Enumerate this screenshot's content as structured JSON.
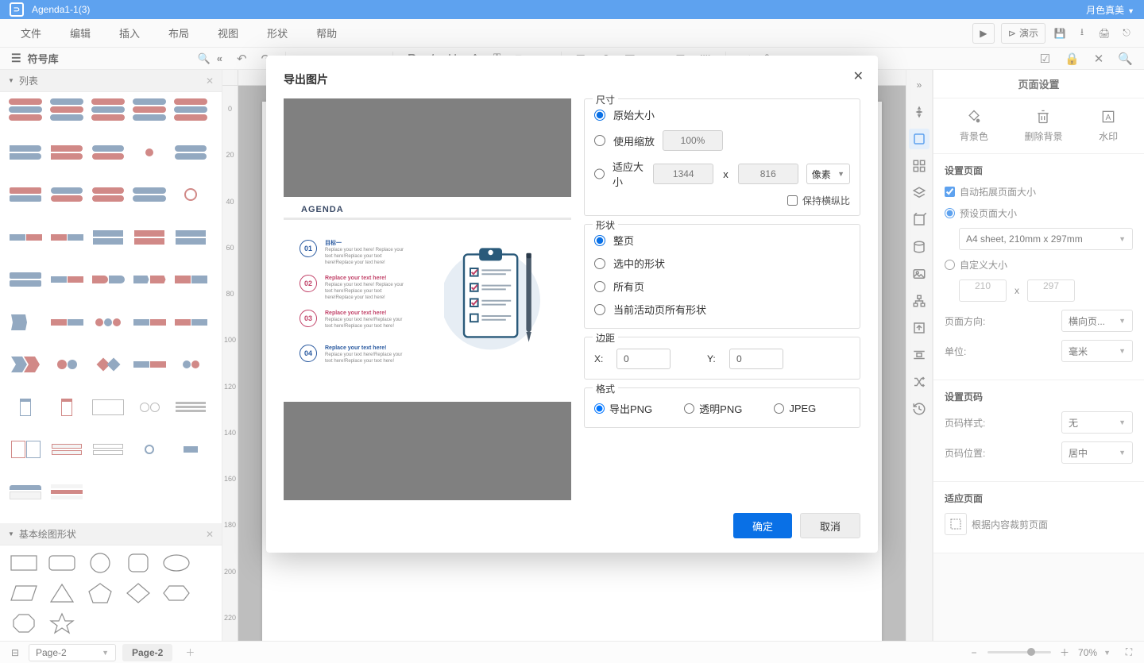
{
  "titlebar": {
    "doc_title": "Agenda1-1(3)",
    "username": "月色真美"
  },
  "menubar": {
    "items": [
      "文件",
      "编辑",
      "插入",
      "布局",
      "视图",
      "形状",
      "帮助"
    ],
    "present_label": "演示"
  },
  "toolbar": {
    "label": "符号库"
  },
  "leftpanel": {
    "section1": "列表",
    "section2": "基本绘图形状"
  },
  "ruler_v": [
    "0",
    "20",
    "40",
    "60",
    "80",
    "100",
    "120",
    "140",
    "160",
    "180",
    "200",
    "220"
  ],
  "proppanel": {
    "title": "页面设置",
    "icon_row": {
      "bgcolor": "背景色",
      "delbg": "删除背景",
      "watermark": "水印"
    },
    "section_page": {
      "title": "设置页面",
      "auto_expand": "自动拓展页面大小",
      "preset_size": "预设页面大小",
      "preset_value": "A4 sheet, 210mm x 297mm",
      "custom_size": "自定义大小",
      "custom_w": "210",
      "custom_h": "297",
      "orientation_label": "页面方向:",
      "orientation_value": "横向页...",
      "unit_label": "单位:",
      "unit_value": "毫米"
    },
    "section_num": {
      "title": "设置页码",
      "style_label": "页码样式:",
      "style_value": "无",
      "pos_label": "页码位置:",
      "pos_value": "居中"
    },
    "section_fit": {
      "title": "适应页面",
      "crop_label": "根据内容裁剪页面"
    }
  },
  "footer": {
    "page_dd": "Page-2",
    "tab": "Page-2",
    "zoom": "70%"
  },
  "modal": {
    "title": "导出图片",
    "preview": {
      "agenda_title": "AGENDA",
      "entries": [
        {
          "num": "01",
          "color": "#2a5aa0",
          "hdr": "目标一",
          "body": "Replace your text here!  Replace your text here!Replace your text here!Replace your text here!"
        },
        {
          "num": "02",
          "color": "#c2446a",
          "hdr": "Replace your text here!",
          "body": "Replace your text here!  Replace your text here!Replace your text here!Replace your text here!"
        },
        {
          "num": "03",
          "color": "#c2446a",
          "hdr": "Replace your text here!",
          "body": "Replace your text here!Replace your text here!Replace your text here!"
        },
        {
          "num": "04",
          "color": "#2a5aa0",
          "hdr": "Replace your text here!",
          "body": "Replace your text here!Replace your text here!Replace your text here!"
        }
      ]
    },
    "size": {
      "legend": "尺寸",
      "original": "原始大小",
      "scale": "使用缩放",
      "scale_ph": "100%",
      "fit": "适应大小",
      "fit_w": "1344",
      "fit_h": "816",
      "fit_unit": "像素",
      "keep_ratio": "保持横纵比"
    },
    "shape": {
      "legend": "形状",
      "full": "整页",
      "selected": "选中的形状",
      "all_pages": "所有页",
      "active_all": "当前活动页所有形状"
    },
    "margin": {
      "legend": "边距",
      "x": "X:",
      "y": "Y:",
      "xv": "0",
      "yv": "0"
    },
    "format": {
      "legend": "格式",
      "png": "导出PNG",
      "trans": "透明PNG",
      "jpeg": "JPEG"
    },
    "buttons": {
      "ok": "确定",
      "cancel": "取消"
    }
  }
}
